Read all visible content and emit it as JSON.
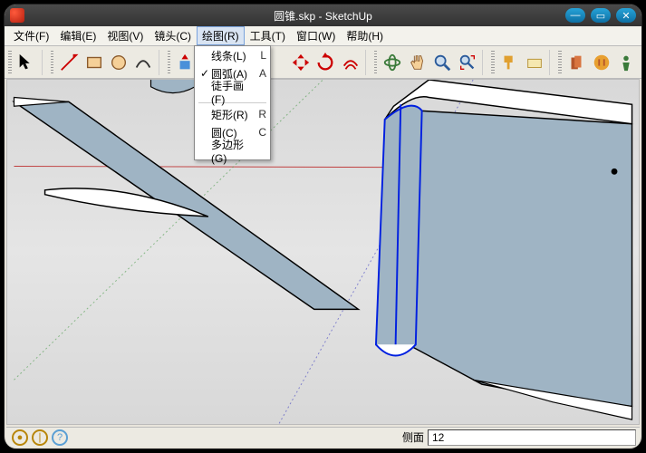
{
  "title": "圆锥.skp - SketchUp",
  "menus": {
    "file": "文件(F)",
    "edit": "编辑(E)",
    "view": "视图(V)",
    "camera": "镜头(C)",
    "draw": "绘图(R)",
    "tools": "工具(T)",
    "window": "窗口(W)",
    "help": "帮助(H)"
  },
  "draw_menu": {
    "line": {
      "label": "线条(L)",
      "shortcut": "L"
    },
    "arc": {
      "label": "圆弧(A)",
      "shortcut": "A",
      "checked": true
    },
    "freehand": {
      "label": "徒手画(F)",
      "shortcut": ""
    },
    "rect": {
      "label": "矩形(R)",
      "shortcut": "R"
    },
    "circle": {
      "label": "圆(C)",
      "shortcut": "C"
    },
    "polygon": {
      "label": "多边形(G)",
      "shortcut": ""
    }
  },
  "status": {
    "label": "侧面",
    "value": "12"
  }
}
